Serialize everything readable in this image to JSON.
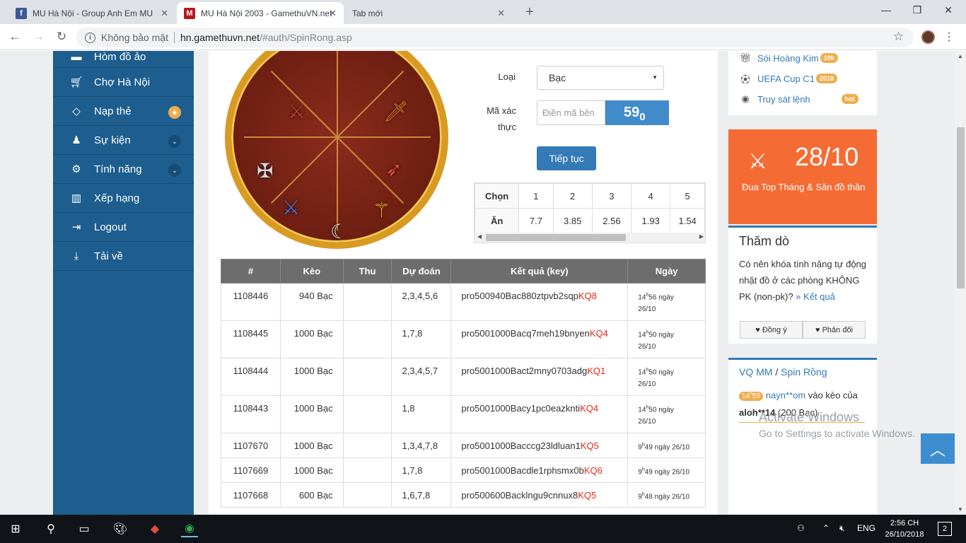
{
  "browser": {
    "tabs": [
      {
        "title": "MU Hà Nội - Group Anh Em MU",
        "icon": "facebook-icon",
        "color": "#3b5998"
      },
      {
        "title": "MU Hà Nội 2003 - GamethuVN.net",
        "icon": "mu-game-icon",
        "color": "#b31b1b"
      },
      {
        "title": "Tab mới",
        "icon": "",
        "color": ""
      }
    ],
    "security_label": "Không bảo mật",
    "url_host": "hn.gamethuvn.net",
    "url_path": "/#auth/SpinRong.asp"
  },
  "sidebar": {
    "items": [
      {
        "label": "Hòm đồ ảo",
        "icon": "chest-icon"
      },
      {
        "label": "Chợ Hà Nội",
        "icon": "cart-icon"
      },
      {
        "label": "Nạp thẻ",
        "icon": "diamond-icon",
        "badge": "★"
      },
      {
        "label": "Sự kiện",
        "icon": "android-icon",
        "chevron": "⌄"
      },
      {
        "label": "Tính năng",
        "icon": "cogs-icon",
        "chevron": "⌄"
      },
      {
        "label": "Xếp hạng",
        "icon": "bar-chart-icon"
      },
      {
        "label": "Logout",
        "icon": "sign-out-icon"
      },
      {
        "label": "Tải về",
        "icon": "download-icon"
      }
    ]
  },
  "spin_form": {
    "loai_label": "Loại",
    "loai_value": "Bạc",
    "captcha_label_1": "Mã xác",
    "captcha_label_2": "thực",
    "captcha_placeholder": "Điền mã bên",
    "captcha_code_main": "59",
    "captcha_code_sub": "0",
    "continue_label": "Tiếp tục"
  },
  "odds_table": {
    "row_chon": "Chọn",
    "row_an": "Ăn",
    "choices": [
      "1",
      "2",
      "3",
      "4",
      "5"
    ],
    "payouts": [
      "7.7",
      "3.85",
      "2.56",
      "1.93",
      "1.54"
    ]
  },
  "results_table": {
    "headers": [
      "#",
      "Kèo",
      "Thu",
      "Dự đoán",
      "Kết quả (key)",
      "Ngày"
    ],
    "rows": [
      {
        "id": "1108446",
        "bet": "940 Bạc",
        "thu": "",
        "pick": "2,3,4,5,6",
        "key": "pro500940Bac880ztpvb2sqp",
        "kq": "KQ8",
        "h": "14",
        "m": "56 ngày",
        "d": "26/10"
      },
      {
        "id": "1108445",
        "bet": "1000 Bạc",
        "thu": "",
        "pick": "1,7,8",
        "key": "pro5001000Bacq7meh19bnyen",
        "kq": "KQ4",
        "h": "14",
        "m": "50 ngày",
        "d": "26/10"
      },
      {
        "id": "1108444",
        "bet": "1000 Bạc",
        "thu": "",
        "pick": "2,3,4,5,7",
        "key": "pro5001000Bact2mny0703adg",
        "kq": "KQ1",
        "h": "14",
        "m": "50 ngày",
        "d": "26/10"
      },
      {
        "id": "1108443",
        "bet": "1000 Bạc",
        "thu": "",
        "pick": "1,8",
        "key": "pro5001000Bacy1pc0eazknti",
        "kq": "KQ4",
        "h": "14",
        "m": "50 ngày",
        "d": "26/10"
      },
      {
        "id": "1107670",
        "bet": "1000 Bạc",
        "thu": "",
        "pick": "1,3,4,7,8",
        "key": "pro5001000Bacccg23ldluan1",
        "kq": "KQ5",
        "h": "9",
        "m": "49 ngày 26/10",
        "d": ""
      },
      {
        "id": "1107669",
        "bet": "1000 Bạc",
        "thu": "",
        "pick": "1,7,8",
        "key": "pro5001000Bacdle1rphsmx0b",
        "kq": "KQ6",
        "h": "9",
        "m": "49 ngày 26/10",
        "d": ""
      },
      {
        "id": "1107668",
        "bet": "600 Bạc",
        "thu": "",
        "pick": "1,6,7,8",
        "key": "pro500600Backlngu9cnnux8",
        "kq": "KQ5",
        "h": "9",
        "m": "48 ngày 26/10",
        "d": ""
      }
    ]
  },
  "right_links": [
    {
      "label": "Sói Hoàng Kim",
      "icon": "gift-icon",
      "tag": "10k"
    },
    {
      "label": "UEFA Cup C1",
      "icon": "soccer-ball-icon",
      "tag": "2018"
    },
    {
      "label": "Truy sát lệnh",
      "icon": "github-cat-icon",
      "tag": "hot"
    }
  ],
  "event": {
    "date": "28/10",
    "text": "Đua Top Tháng & Săn đồ thần"
  },
  "poll": {
    "title": "Thăm dò",
    "question": "Có nên khóa tính năng tự động nhặt đồ ở các phòng KHÔNG PK (non-pk)?",
    "result_link": "» Kết quả",
    "agree": "Đồng ý",
    "disagree": "Phản đối"
  },
  "vq": {
    "title_1": "VQ MM",
    "sep": " / ",
    "title_2": "Spin Rồng",
    "time_h": "14",
    "time_m": "55",
    "user": "nayn**om",
    "mid": " vào kèo của ",
    "target": "aloh**14",
    "amount": " (200 Bạc)"
  },
  "watermark": {
    "line1": "Activate Windows",
    "line2": "Go to Settings to activate Windows."
  },
  "taskbar": {
    "lang": "ENG",
    "time": "2:56 CH",
    "date": "26/10/2018",
    "notifications": "2"
  }
}
